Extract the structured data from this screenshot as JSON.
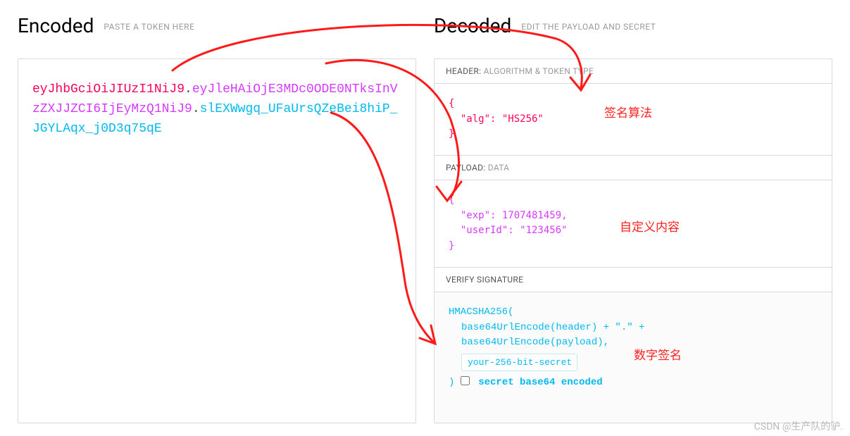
{
  "encoded": {
    "title": "Encoded",
    "subtitle": "PASTE A TOKEN HERE",
    "token_header": "eyJhbGciOiJIUzI1NiJ9",
    "token_payload": "eyJleHAiOjE3MDc0ODE0NTksInVzZXJJZCI6IjEyMzQ1NiJ9",
    "token_signature": "slEXWwgq_UFaUrsQZeBei8hiP_JGYLAqx_j0D3q75qE"
  },
  "decoded": {
    "title": "Decoded",
    "subtitle": "EDIT THE PAYLOAD AND SECRET",
    "header_section": {
      "label": "HEADER:",
      "sub": "ALGORITHM & TOKEN TYPE",
      "json": "{\n  \"alg\": \"HS256\"\n}"
    },
    "payload_section": {
      "label": "PAYLOAD:",
      "sub": "DATA",
      "json": "{\n  \"exp\": 1707481459,\n  \"userId\": \"123456\"\n}"
    },
    "signature_section": {
      "label": "VERIFY SIGNATURE",
      "line1": "HMACSHA256(",
      "line2": "base64UrlEncode(header) + \".\" +",
      "line3": "base64UrlEncode(payload),",
      "secret_value": "your-256-bit-secret",
      "close_paren": ")",
      "checkbox_label": "secret base64 encoded"
    }
  },
  "annotations": {
    "a1": "签名算法",
    "a2": "自定义内容",
    "a3": "数字签名"
  },
  "watermark": "CSDN @生产队的驴."
}
